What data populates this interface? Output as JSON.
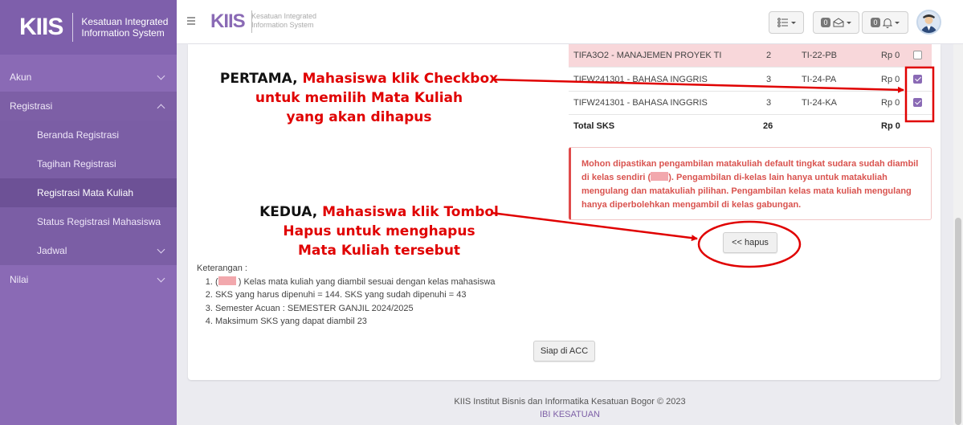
{
  "brand": {
    "logo": "KIIS",
    "line1": "Kesatuan Integrated",
    "line2": "Information System"
  },
  "topbar": {
    "logo": "KIIS",
    "line1": "Kesatuan Integrated",
    "line2": "Information System",
    "messages_count": "0",
    "notifications_count": "0"
  },
  "sidebar": {
    "items": [
      {
        "label": "Akun"
      },
      {
        "label": "Registrasi"
      },
      {
        "label": "Nilai"
      }
    ],
    "registrasi_sub": [
      {
        "label": "Beranda Registrasi"
      },
      {
        "label": "Tagihan Registrasi"
      },
      {
        "label": "Registrasi Mata Kuliah"
      },
      {
        "label": "Status Registrasi Mahasiswa"
      },
      {
        "label": "Jadwal"
      }
    ]
  },
  "table": {
    "rows": [
      {
        "course": "TIFA3O2 - MANAJEMEN PROYEK TI",
        "sks": "2",
        "class": "TI-22-PB",
        "cost": "Rp 0",
        "checked": false
      },
      {
        "course": "TIFW241301 - BAHASA INGGRIS",
        "sks": "3",
        "class": "TI-24-PA",
        "cost": "Rp 0",
        "checked": true
      },
      {
        "course": "TIFW241301 - BAHASA INGGRIS",
        "sks": "3",
        "class": "TI-24-KA",
        "cost": "Rp 0",
        "checked": true
      }
    ],
    "total_label": "Total SKS",
    "total_sks": "26",
    "total_cost": "Rp 0"
  },
  "alert": {
    "part1": "Mohon dipastikan pengambilan matakuliah default tingkat sudara sudah diambil di kelas sendiri (",
    "part2": "). Pengambilan di-kelas lain hanya untuk matakuliah mengulang dan matakuliah pilihan. Pengambilan kelas mata kuliah mengulang hanya diperbolehkan mengambil di kelas gabungan."
  },
  "buttons": {
    "hapus": "<< hapus",
    "siap": "Siap di ACC"
  },
  "keterangan": {
    "title": "Keterangan :",
    "item1_prefix": "(",
    "item1_suffix": ") Kelas mata kuliah yang diambil sesuai dengan kelas mahasiswa",
    "item2": "SKS yang harus dipenuhi = 144. SKS yang sudah dipenuhi = 43",
    "item3": "Semester Acuan : SEMESTER GANJIL 2024/2025",
    "item4": "Maksimum SKS yang dapat diambil 23"
  },
  "annotations": {
    "first_black": "PERTAMA,",
    "first_red1": "Mahasiswa klik Checkbox",
    "first_red2": "untuk memilih Mata Kuliah",
    "first_red3": "yang akan dihapus",
    "second_black": "KEDUA,",
    "second_red1": "Mahasiswa klik Tombol",
    "second_red2": "Hapus untuk menghapus",
    "second_red3": "Mata Kuliah tersebut"
  },
  "footer": {
    "line1": "KIIS Institut Bisnis dan Informatika Kesatuan Bogor © 2023",
    "line2": "IBI KESATUAN"
  },
  "colors": {
    "sidebar": "#8a6ab5",
    "accent": "#8a6ab5",
    "annotation": "#e00000",
    "highlight_row": "#f8d7da"
  }
}
